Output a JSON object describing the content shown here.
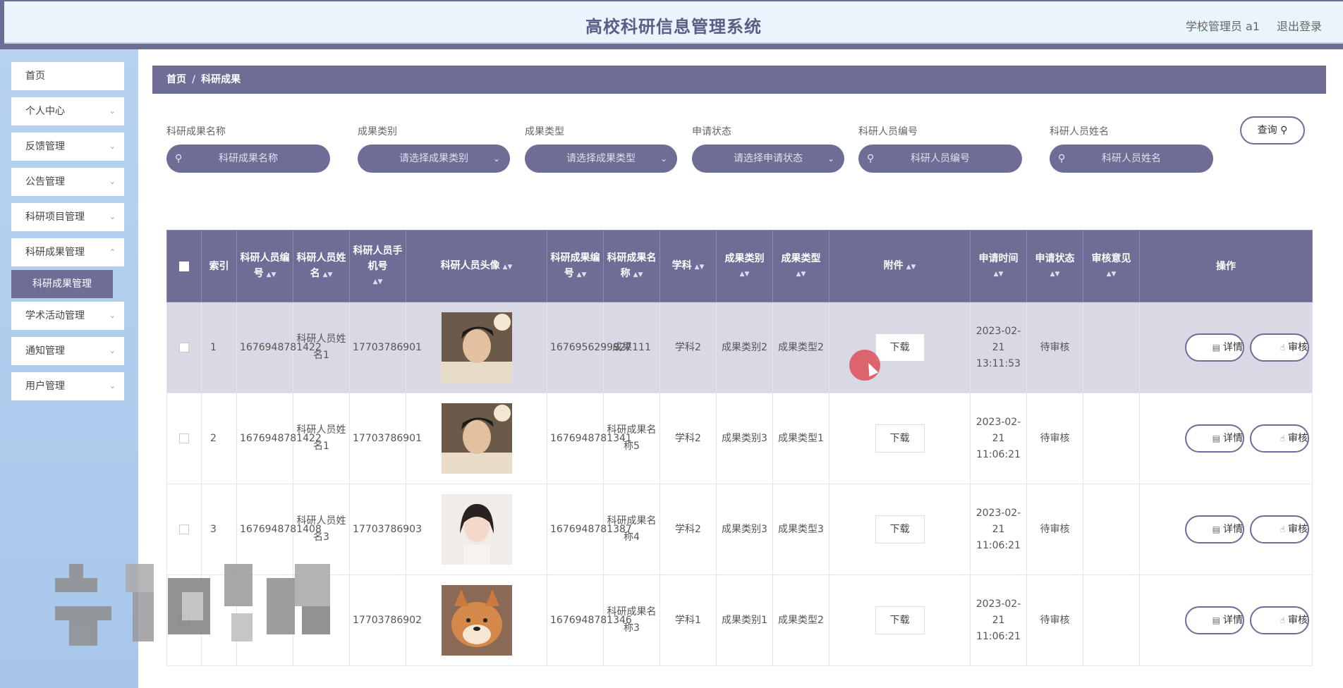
{
  "header": {
    "title": "高校科研信息管理系统",
    "user": "学校管理员 a1",
    "logout": "退出登录"
  },
  "sidebar": {
    "items": [
      {
        "label": "首页",
        "has_arrow": false
      },
      {
        "label": "个人中心",
        "has_arrow": true
      },
      {
        "label": "反馈管理",
        "has_arrow": true
      },
      {
        "label": "公告管理",
        "has_arrow": true
      },
      {
        "label": "科研项目管理",
        "has_arrow": true
      },
      {
        "label": "科研成果管理",
        "has_arrow": true
      },
      {
        "label": "学术活动管理",
        "has_arrow": true
      },
      {
        "label": "通知管理",
        "has_arrow": true
      },
      {
        "label": "用户管理",
        "has_arrow": true
      }
    ],
    "sub_item": "科研成果管理"
  },
  "breadcrumb": {
    "home": "首页",
    "sep": "/",
    "current": "科研成果"
  },
  "search": {
    "fields": [
      {
        "label": "科研成果名称",
        "placeholder": "科研成果名称",
        "type": "text"
      },
      {
        "label": "成果类别",
        "placeholder": "请选择成果类别",
        "type": "select"
      },
      {
        "label": "成果类型",
        "placeholder": "请选择成果类型",
        "type": "select"
      },
      {
        "label": "申请状态",
        "placeholder": "请选择申请状态",
        "type": "select"
      },
      {
        "label": "科研人员编号",
        "placeholder": "科研人员编号",
        "type": "text"
      },
      {
        "label": "科研人员姓名",
        "placeholder": "科研人员姓名",
        "type": "text"
      }
    ],
    "query_label": "查询"
  },
  "table": {
    "headers": {
      "index": "索引",
      "staff_no": "科研人员编号",
      "staff_name": "科研人员姓名",
      "phone": "科研人员手机号",
      "avatar": "科研人员头像",
      "result_no": "科研成果编号",
      "result_name": "科研成果名称",
      "subject": "学科",
      "category": "成果类别",
      "type": "成果类型",
      "attachment": "附件",
      "apply_time": "申请时间",
      "status": "申请状态",
      "review": "审核意见",
      "ops": "操作"
    },
    "download_label": "下载",
    "detail_label": "详情",
    "audit_label": "审核",
    "rows": [
      {
        "index": "1",
        "staff_no": "1676948781422",
        "staff_name": "科研人员姓名1",
        "phone": "17703786901",
        "avatar": "man",
        "result_no": "1676956299927",
        "result_name": "成果111",
        "subject": "学科2",
        "category": "成果类别2",
        "type": "成果类型2",
        "apply_time": "2023-02-21 13:11:53",
        "status": "待审核",
        "review": ""
      },
      {
        "index": "2",
        "staff_no": "1676948781422",
        "staff_name": "科研人员姓名1",
        "phone": "17703786901",
        "avatar": "man",
        "result_no": "1676948781341",
        "result_name": "科研成果名称5",
        "subject": "学科2",
        "category": "成果类别3",
        "type": "成果类型1",
        "apply_time": "2023-02-21 11:06:21",
        "status": "待审核",
        "review": ""
      },
      {
        "index": "3",
        "staff_no": "1676948781408",
        "staff_name": "科研人员姓名3",
        "phone": "17703786903",
        "avatar": "woman",
        "result_no": "1676948781387",
        "result_name": "科研成果名称4",
        "subject": "学科2",
        "category": "成果类别3",
        "type": "成果类型3",
        "apply_time": "2023-02-21 11:06:21",
        "status": "待审核",
        "review": ""
      },
      {
        "index": "",
        "staff_no": "",
        "staff_name": "",
        "phone": "17703786902",
        "avatar": "dog",
        "result_no": "1676948781346",
        "result_name": "科研成果名称3",
        "subject": "学科1",
        "category": "成果类别1",
        "type": "成果类型2",
        "apply_time": "2023-02-21 11:06:21",
        "status": "待审核",
        "review": ""
      }
    ]
  },
  "colors": {
    "primary": "#6d6d96",
    "header_bg": "#e9f4fc",
    "sidebar_bg": "#b7d3f1",
    "highlight_row": "#d9d9e6"
  },
  "icons": {
    "search": "search-icon",
    "dropdown": "chevron-down-icon",
    "detail": "document-icon",
    "audit": "hand-pointer-icon"
  }
}
